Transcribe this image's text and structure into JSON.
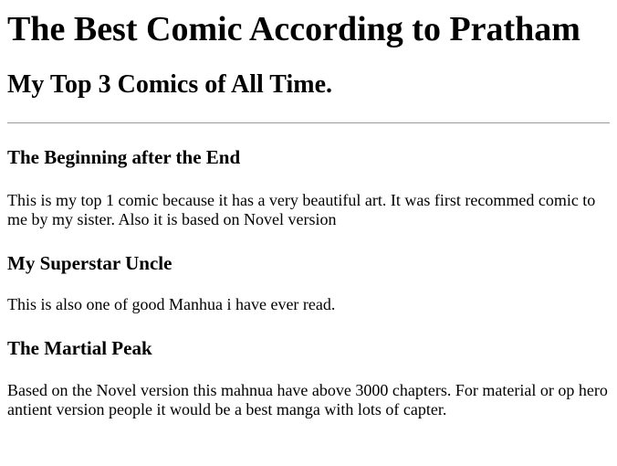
{
  "page": {
    "title": "The Best Comic According to Pratham",
    "subtitle": "My Top 3 Comics of All Time."
  },
  "comics": [
    {
      "title": "The Beginning after the End",
      "description": "This is my top 1 comic because it has a very beautiful art. It was first recommed comic to me by my sister. Also it is based on Novel version"
    },
    {
      "title": "My Superstar Uncle",
      "description": "This is also one of good Manhua i have ever read."
    },
    {
      "title": "The Martial Peak",
      "description": "Based on the Novel version this mahnua have above 3000 chapters. For material or op hero antient version people it would be a best manga with lots of capter."
    }
  ]
}
